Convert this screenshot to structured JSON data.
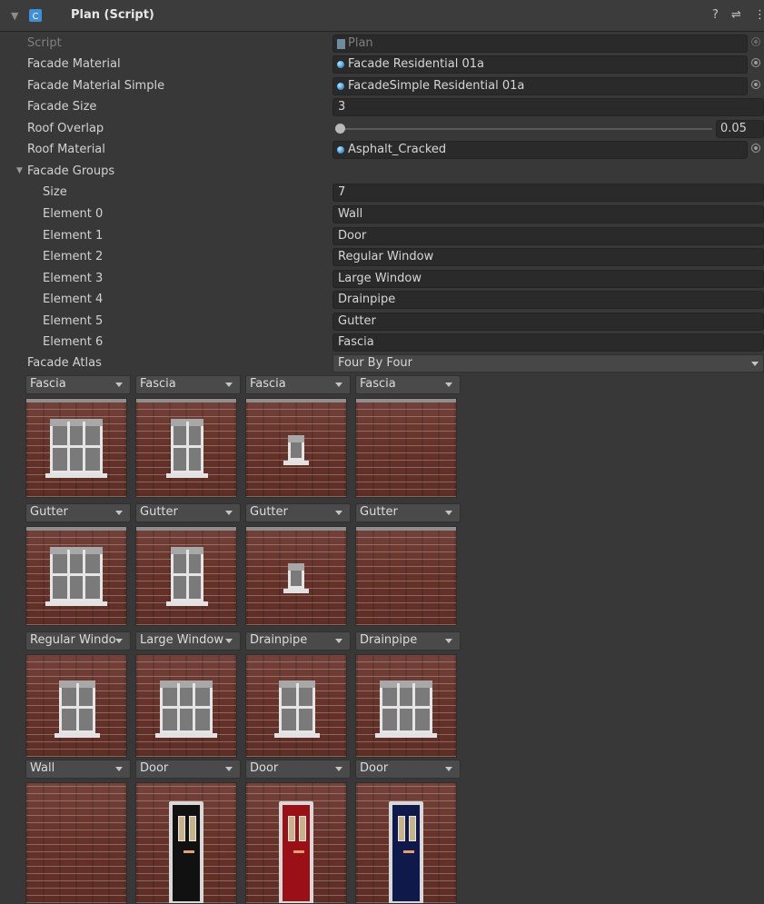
{
  "header": {
    "title": "Plan (Script)",
    "help_icon": "?",
    "settings_icon": "⇌",
    "menu_icon": "⋮"
  },
  "properties": {
    "script": {
      "label": "Script",
      "value": "Plan"
    },
    "facade_material": {
      "label": "Facade Material",
      "value": "Facade Residential 01a"
    },
    "facade_material_simple": {
      "label": "Facade Material Simple",
      "value": "FacadeSimple Residential 01a"
    },
    "facade_size": {
      "label": "Facade Size",
      "value": "3"
    },
    "roof_overlap": {
      "label": "Roof Overlap",
      "value": "0.05",
      "fraction": 0.0
    },
    "roof_material": {
      "label": "Roof Material",
      "value": "Asphalt_Cracked"
    },
    "facade_groups": {
      "label": "Facade Groups",
      "size_label": "Size",
      "size_value": "7",
      "elements": [
        {
          "label": "Element 0",
          "value": "Wall"
        },
        {
          "label": "Element 1",
          "value": "Door"
        },
        {
          "label": "Element 2",
          "value": "Regular Window"
        },
        {
          "label": "Element 3",
          "value": "Large Window"
        },
        {
          "label": "Element 4",
          "value": "Drainpipe"
        },
        {
          "label": "Element 5",
          "value": "Gutter"
        },
        {
          "label": "Element 6",
          "value": "Fascia"
        }
      ]
    },
    "facade_atlas": {
      "label": "Facade Atlas",
      "value": "Four By Four"
    }
  },
  "atlas_grid": [
    [
      "Fascia",
      "Fascia",
      "Fascia",
      "Fascia"
    ],
    [
      "Gutter",
      "Gutter",
      "Gutter",
      "Gutter"
    ],
    [
      "Regular Windo",
      "Large Window",
      "Drainpipe",
      "Drainpipe"
    ],
    [
      "Wall",
      "Door",
      "Door",
      "Door"
    ]
  ],
  "colors": {
    "background": "#383838",
    "field": "#2a2a2a",
    "brick": "#6d3a30",
    "door_black": "#111111",
    "door_red": "#9b0f16",
    "door_navy": "#0f1a4a"
  }
}
